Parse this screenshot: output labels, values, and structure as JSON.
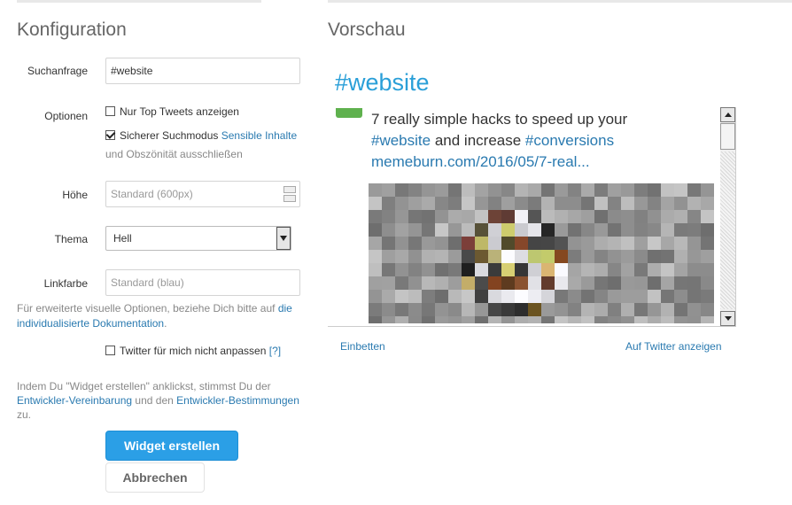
{
  "config": {
    "heading": "Konfiguration",
    "search_label": "Suchanfrage",
    "search_value": "#website",
    "options_label": "Optionen",
    "top_tweets_label": "Nur Top Tweets anzeigen",
    "top_tweets_checked": false,
    "safe_mode_label": "Sicherer Suchmodus",
    "safe_mode_link": "Sensible Inhalte",
    "safe_mode_rest": "und Obszönität ausschließen",
    "safe_mode_checked": true,
    "height_label": "Höhe",
    "height_placeholder": "Standard (600px)",
    "theme_label": "Thema",
    "theme_value": "Hell",
    "link_color_label": "Linkfarbe",
    "link_color_placeholder": "Standard (blau)",
    "advanced_text": "Für erweiterte visuelle Optionen, beziehe Dich bitte auf",
    "advanced_link_1": "die",
    "advanced_link_2": "individualisierte Dokumentation",
    "advanced_end": ".",
    "no_tailor_label": "Twitter für mich nicht anpassen",
    "no_tailor_checked": false,
    "help_link": "[?]",
    "legal_text_1": "Indem Du \"Widget erstellen\" anklickst, stimmst Du der",
    "legal_link_1": "Entwickler-Vereinbarung",
    "legal_text_2": "und den",
    "legal_link_2": "Entwickler-Bestimmungen",
    "legal_text_3": "zu.",
    "create_button": "Widget erstellen",
    "cancel_button": "Abbrechen"
  },
  "preview": {
    "heading": "Vorschau",
    "widget_title": "#website",
    "tweet": {
      "line1": "7 really simple hacks to speed up your",
      "hashtag1": "#website",
      "middle": "and increase",
      "hashtag2": "#conversions",
      "link": "memeburn.com/2016/05/7-real..."
    },
    "embed_link": "Einbetten",
    "twitter_link": "Auf Twitter anzeigen"
  },
  "colors": {
    "accent": "#2b9fe6",
    "link": "#2a7ab0",
    "heading": "#666666"
  }
}
